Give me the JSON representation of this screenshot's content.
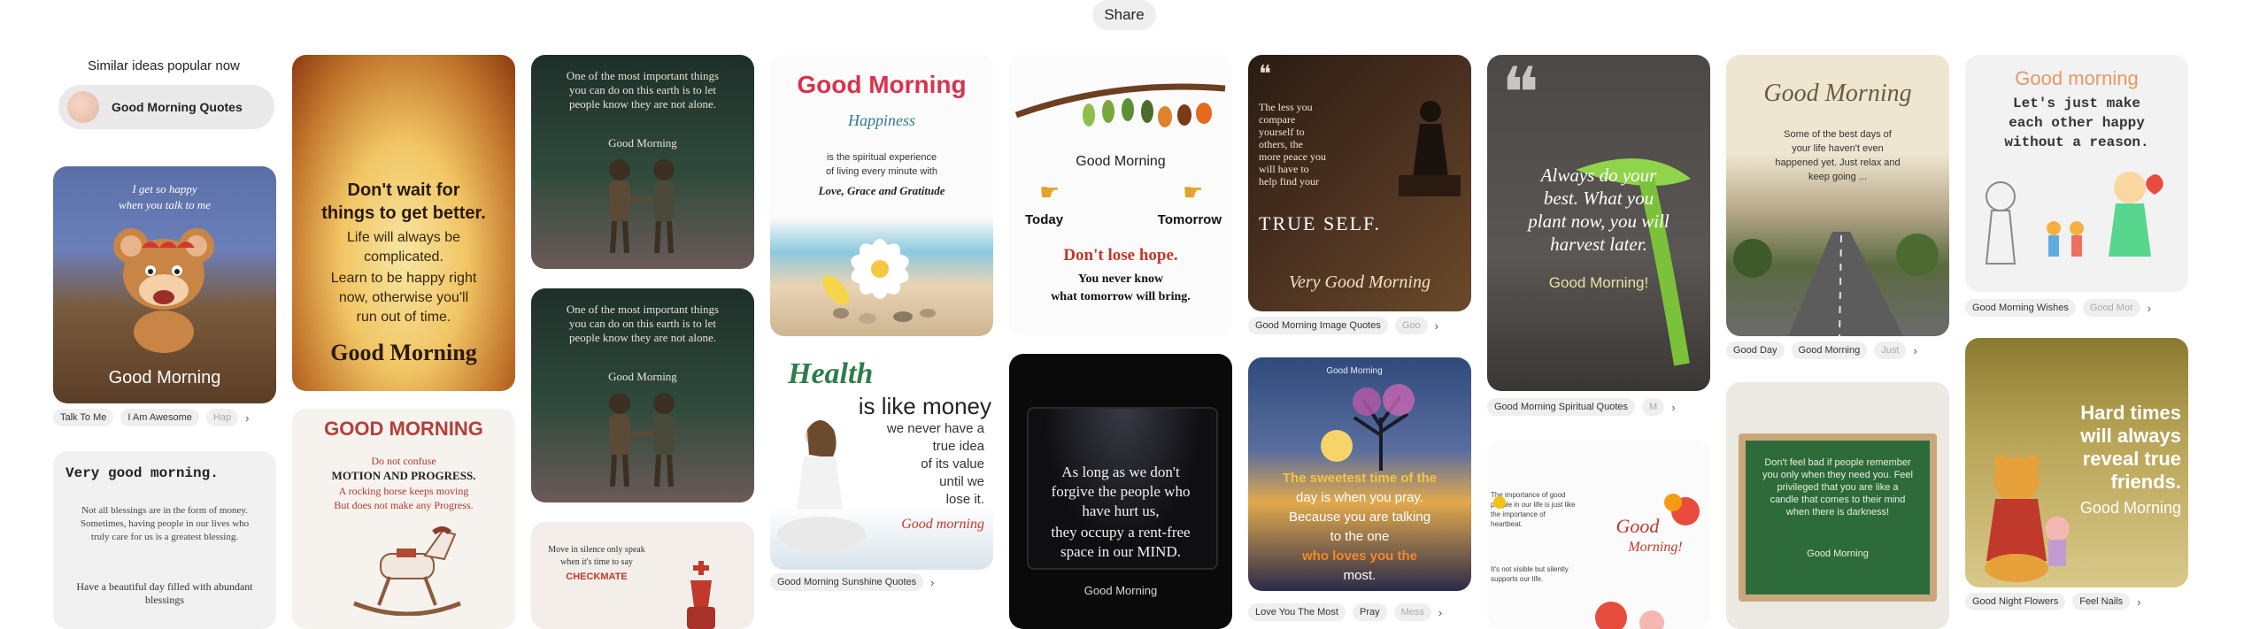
{
  "share_label": "Share",
  "similar": {
    "title": "Similar ideas popular now",
    "pill_label": "Good Morning Quotes"
  },
  "pins": {
    "c1a": {
      "line1": "I get so happy",
      "line2": "when you talk to me",
      "bottom": "Good Morning"
    },
    "c1a_tags": [
      "Talk To Me",
      "I Am Awesome",
      "Hap"
    ],
    "c1b": {
      "title": "Very good morning.",
      "body": "Not all blessings are in the form of money. Sometimes, having people in our lives who truly care for us is a greatest blessing.",
      "footer": "Have a beautiful day filled with abundant blessings"
    },
    "c2a": {
      "l1": "Don't wait for",
      "l2": "things to get better.",
      "l3": "Life will always be",
      "l4": "complicated.",
      "l5": "Learn to be happy right",
      "l6": "now, otherwise you'll",
      "l7": "run out of time.",
      "bottom": "Good Morning"
    },
    "c2b": {
      "title": "GOOD MORNING",
      "l1": "Do not confuse",
      "l2": "MOTION AND PROGRESS.",
      "l3": "A rocking horse keeps moving",
      "l4": "But does not make any Progress."
    },
    "c3a": {
      "quote": "One of the most important things you can do on this earth is to let people know they are not alone.",
      "gm": "Good Morning"
    },
    "c3b": {
      "quote": "One of the most important things you can do on this earth is to let people know they are not alone.",
      "gm": "Good Morning"
    },
    "c3c": {
      "l1": "Move in silence only speak",
      "l2": "when it's time to say",
      "l3": "CHECKMATE"
    },
    "c4a": {
      "title": "Good Morning",
      "script": "Happiness",
      "l1": "is the spiritual experience",
      "l2": "of living every minute with",
      "l3": "Love, Grace and Gratitude"
    },
    "c4b": {
      "w1": "Health",
      "w2": "is like money",
      "w3": "we never have a",
      "w4": "true idea",
      "w5": "of its value",
      "w6": "until we",
      "w7": "lose it.",
      "w8": "Good morning"
    },
    "c4b_tags": [
      "Good Morning Sunshine Quotes"
    ],
    "c5a": {
      "gm": "Good Morning",
      "today": "Today",
      "tomorrow": "Tomorrow",
      "l1": "Don't lose hope.",
      "l2": "You never know",
      "l3": "what tomorrow will bring."
    },
    "c5b": {
      "l1": "As long as we don't",
      "l2": "forgive the people who",
      "l3": "have hurt us,",
      "l4": "they occupy a rent-free",
      "l5": "space in our MIND.",
      "gm": "Good Morning"
    },
    "c6a": {
      "q1": "The less you",
      "q2": "compare",
      "q3": "yourself to",
      "q4": "others, the",
      "q5": "more peace you",
      "q6": "will have to",
      "q7": "help find your",
      "big": "TRUE SELF.",
      "bottom": "Very Good Morning"
    },
    "c6a_tags": [
      "Good Morning Image Quotes",
      "Goo"
    ],
    "c6b": {
      "small": "Good Morning",
      "l1": "The sweetest time of the",
      "l2": "day is when you pray.",
      "l3": "Because you are talking",
      "l4": "to the one",
      "l5": "who loves you the",
      "l6": "most."
    },
    "c6b_tags": [
      "Love You The Most",
      "Pray",
      "Mess"
    ],
    "c7a": {
      "l1": "Always do your",
      "l2": "best. What you",
      "l3": "plant now, you will",
      "l4": "harvest later.",
      "gm": "Good Morning!"
    },
    "c7a_tags": [
      "Good Morning Spiritual Quotes",
      "M"
    ],
    "c7b": {
      "small": "The importance of good people in our life is just like the importance of heartbeat.",
      "gm1": "Good",
      "gm2": "Morning!",
      "small2": "It's not visible but silently supports our life."
    },
    "c8a": {
      "title": "Good Morning",
      "l1": "Some of the best days of",
      "l2": "your life haven't even",
      "l3": "happened yet. Just relax and",
      "l4": "keep going ..."
    },
    "c8a_tags": [
      "Good Day",
      "Good Morning",
      "Just"
    ],
    "c8b": {
      "quote": "Don't feel bad if people remember you only when they need you. Feel privileged that you are like a candle that comes to their mind when there is darkness!",
      "gm": "Good Morning"
    },
    "c9a": {
      "gm": "Good morning",
      "l1": "Let's just make",
      "l2": "each other happy",
      "l3": "without a reason."
    },
    "c9a_tags": [
      "Good Morning Wishes",
      "Good Mor"
    ],
    "c9b": {
      "l1": "Hard times",
      "l2": "will always",
      "l3": "reveal true",
      "l4": "friends.",
      "gm": "Good Morning"
    },
    "c9b_tags": [
      "Good Night Flowers",
      "Feel Nails"
    ]
  },
  "icons": {
    "chevron": "chevron-right-icon",
    "quote": "quote-mark-icon"
  }
}
